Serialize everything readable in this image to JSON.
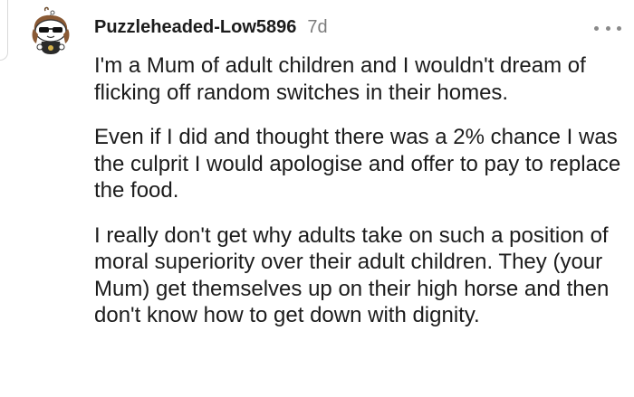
{
  "comment": {
    "username": "Puzzleheaded-Low5896",
    "timestamp": "7d",
    "avatar_icon": "snoo-avatar-icon",
    "more_icon": "more-options-icon",
    "paragraphs": [
      "I'm a Mum of adult children and I wouldn't dream of flicking off random switches in their homes.",
      "Even if I did and thought there was a 2% chance I was the culprit I would apologise and offer to pay to replace the food.",
      "I really don't get why adults take on such a position of moral superiority over their adult children. They (your Mum) get themselves up on their high horse and then don't know how to get down with dignity."
    ]
  }
}
